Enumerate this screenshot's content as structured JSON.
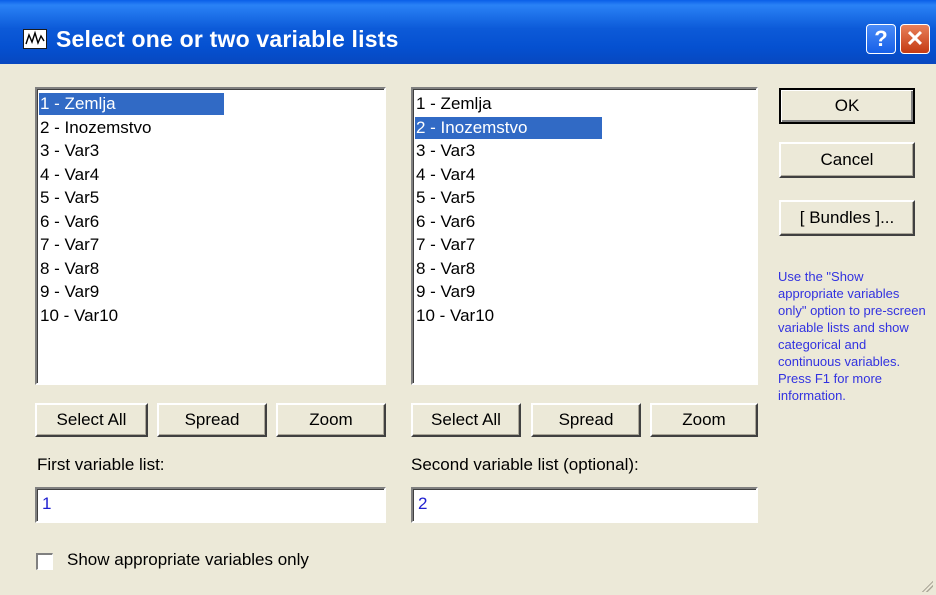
{
  "window": {
    "title": "Select one or two variable lists",
    "help_label": "?",
    "close_label": "✕"
  },
  "list1": {
    "items": [
      "1 - Zemlja",
      "2 - Inozemstvo",
      "3 - Var3",
      "4 - Var4",
      "5 - Var5",
      "6 - Var6",
      "7 - Var7",
      "8 - Var8",
      "9 - Var9",
      "10 - Var10"
    ],
    "selected_index": 0
  },
  "list2": {
    "items": [
      "1 - Zemlja",
      "2 - Inozemstvo",
      "3 - Var3",
      "4 - Var4",
      "5 - Var5",
      "6 - Var6",
      "7 - Var7",
      "8 - Var8",
      "9 - Var9",
      "10 - Var10"
    ],
    "selected_index": 1
  },
  "left_buttons": {
    "select_all": "Select All",
    "spread": "Spread",
    "zoom": "Zoom"
  },
  "right_buttons": {
    "select_all": "Select All",
    "spread": "Spread",
    "zoom": "Zoom"
  },
  "labels": {
    "first_list": "First variable list:",
    "second_list": "Second variable list (optional):"
  },
  "fields": {
    "first_value": "1",
    "second_value": "2"
  },
  "actions": {
    "ok": "OK",
    "cancel": "Cancel",
    "bundles": "[ Bundles ]..."
  },
  "hint_text": "Use the \"Show appropriate variables only\" option to pre-screen variable lists and show categorical and continuous variables. Press F1 for more information.",
  "checkbox": {
    "label": "Show appropriate variables only",
    "checked": false
  },
  "colors": {
    "title_bar": "#0550d0",
    "selection": "#316ac5",
    "hint": "#3232e0",
    "field_text": "#2020d0",
    "background": "#ece9d8"
  }
}
